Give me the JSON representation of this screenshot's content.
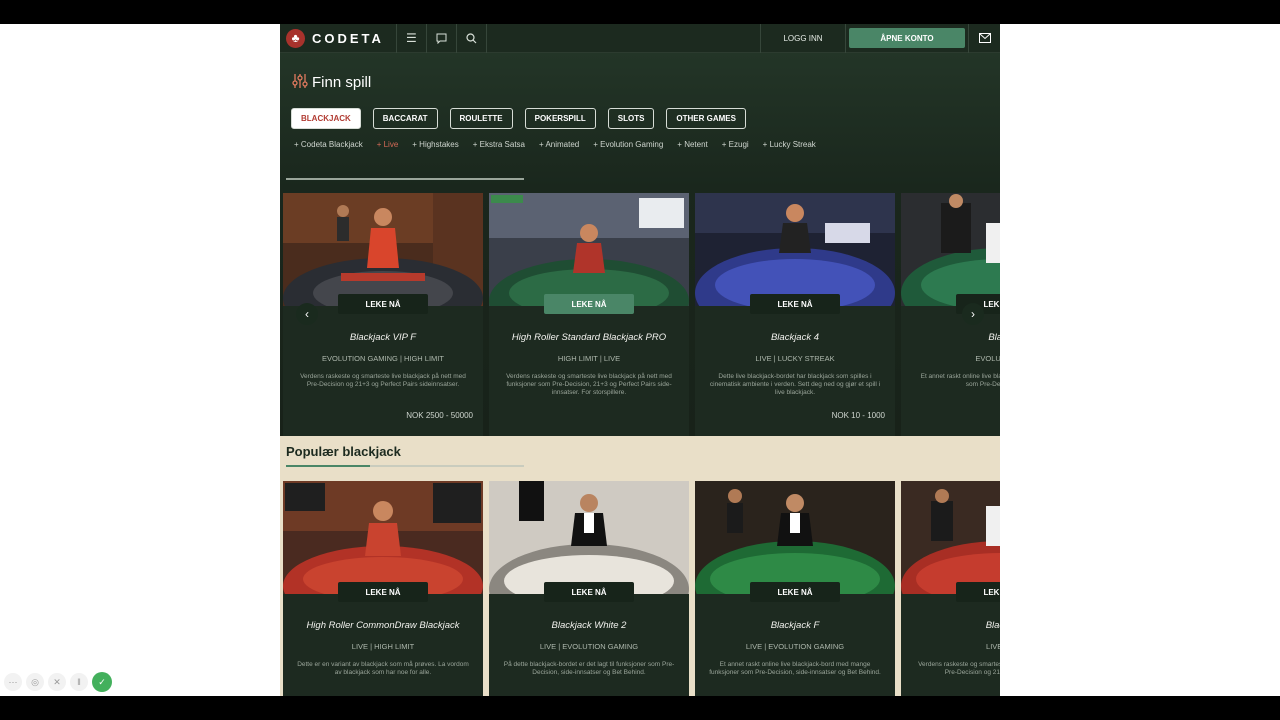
{
  "header": {
    "logo_text": "CODETA",
    "login_label": "LOGG INN",
    "open_account_label": "ÅPNE KONTO"
  },
  "finder": {
    "title": "Finn spill",
    "categories": [
      {
        "label": "BLACKJACK",
        "active": true
      },
      {
        "label": "BACCARAT",
        "active": false
      },
      {
        "label": "ROULETTE",
        "active": false
      },
      {
        "label": "POKERSPILL",
        "active": false
      },
      {
        "label": "SLOTS",
        "active": false
      },
      {
        "label": "OTHER GAMES",
        "active": false
      }
    ],
    "subtags": [
      "+ Codeta Blackjack",
      "+ Live",
      "+ Highstakes",
      "+ Ekstra Satsa",
      "+ Animated",
      "+ Evolution Gaming",
      "+ Netent",
      "+ Ezugi",
      "+ Lucky Streak"
    ]
  },
  "play_label": "LEKE NÅ",
  "top_cards": [
    {
      "title": "Blackjack VIP F",
      "tags": "EVOLUTION GAMING | HIGH LIMIT",
      "desc": "Verdens raskeste og smarteste live blackjack på nett med Pre-Decision og 21+3 og Perfect Pairs sideinnsatser.",
      "limit": "NOK 2500 - 50000"
    },
    {
      "title": "High Roller Standard Blackjack PRO",
      "tags": "HIGH LIMIT | LIVE",
      "desc": "Verdens raskeste og smarteste live blackjack på nett med funksjoner som Pre-Decision, 21+3 og Perfect Pairs side-innsatser. For storspillere.",
      "limit": ""
    },
    {
      "title": "Blackjack 4",
      "tags": "LIVE | LUCKY STREAK",
      "desc": "Dette live blackjack-bordet har blackjack som spilles i cinematisk ambiente i verden. Sett deg ned og gjør et spill i live blackjack.",
      "limit": "NOK 10 - 1000"
    },
    {
      "title": "Blackj",
      "tags": "EVOLUTION G",
      "desc": "Et annet raskt online live blackjack-bord med funksjoner som Pre-Decision, side-i",
      "limit": ""
    }
  ],
  "popular": {
    "title": "Populær blackjack",
    "cards": [
      {
        "title": "High Roller CommonDraw Blackjack",
        "tags": "LIVE | HIGH LIMIT",
        "desc": "Dette er en variant av blackjack som må prøves. La vordom av blackjack som har noe for alle."
      },
      {
        "title": "Blackjack White 2",
        "tags": "LIVE | EVOLUTION GAMING",
        "desc": "På dette blackjack-bordet er det lagt til funksjoner som Pre-Decision, side-innsatser og Bet Behind."
      },
      {
        "title": "Blackjack F",
        "tags": "LIVE | EVOLUTION GAMING",
        "desc": "Et annet raskt online live blackjack-bord med mange funksjoner som Pre-Decision, side-innsatser og Bet Behind."
      },
      {
        "title": "Blackja",
        "tags": "LIVE | HI",
        "desc": "Verdens raskeste og smarteste live blackjack på nett med Pre-Decision og 21+3 og Perfect Pairs."
      }
    ]
  }
}
